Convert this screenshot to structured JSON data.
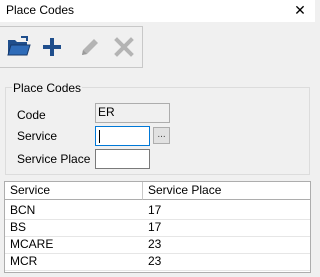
{
  "window": {
    "title": "Place Codes",
    "close_glyph": "✕"
  },
  "toolbar": {
    "buttons": [
      {
        "name": "open-folder-icon",
        "enabled": true
      },
      {
        "name": "add-icon",
        "enabled": true
      },
      {
        "name": "edit-pencil-icon",
        "enabled": false
      },
      {
        "name": "delete-x-icon",
        "enabled": false
      }
    ],
    "accent": "#1f4e8c"
  },
  "form": {
    "group_title": "Place Codes",
    "code_label": "Code",
    "code_value": "ER",
    "service_label": "Service",
    "service_value": "",
    "service_browse": "...",
    "service_place_label": "Service Place",
    "service_place_value": ""
  },
  "table": {
    "columns": [
      "Service",
      "Service Place"
    ],
    "rows": [
      [
        "BCN",
        "17"
      ],
      [
        "BS",
        "17"
      ],
      [
        "MCARE",
        "23"
      ],
      [
        "MCR",
        "23"
      ]
    ]
  }
}
